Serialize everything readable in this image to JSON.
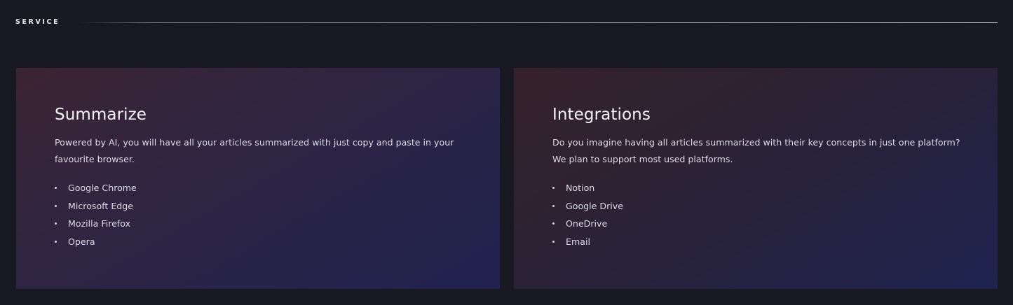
{
  "section": {
    "title": "SERVICE"
  },
  "cards": [
    {
      "title": "Summarize",
      "description": "Powered by AI, you will have all your articles summarized with just copy and paste in your favourite browser.",
      "items": [
        "Google Chrome",
        "Microsoft Edge",
        "Mozilla Firefox",
        "Opera"
      ]
    },
    {
      "title": "Integrations",
      "description": "Do you imagine having all articles summarized with their key concepts in just one platform? We plan to support most used platforms.",
      "items": [
        "Notion",
        "Google Drive",
        "OneDrive",
        "Email"
      ]
    }
  ],
  "colors": {
    "background": "#181822",
    "card_gradient_start": "#3b2433",
    "card_gradient_end": "#202250",
    "text": "#f2f2f6"
  }
}
